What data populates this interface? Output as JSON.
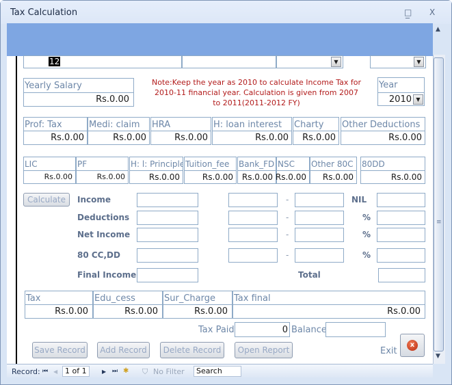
{
  "window": {
    "title": "Tax Calculation",
    "minimize": "_",
    "maximize": "□",
    "close": "X"
  },
  "top_row": {
    "id_value": "12"
  },
  "note": "Note:Keep the year as 2010 to calculate Income Tax for 2010-11 financial year. Calculation is given from 2007 to 2011(2011-2012 FY)",
  "yearly_salary": {
    "label": "Yearly Salary",
    "value": "Rs.0.00"
  },
  "year": {
    "label": "Year",
    "value": "2010"
  },
  "row1": [
    {
      "label": "Prof: Tax",
      "value": "Rs.0.00"
    },
    {
      "label": "Medi: claim",
      "value": "Rs.0.00"
    },
    {
      "label": "HRA",
      "value": "Rs.0.00"
    },
    {
      "label": "H: loan interest",
      "value": "Rs.0.00"
    },
    {
      "label": "Charty",
      "value": "Rs.0.00"
    },
    {
      "label": "Other Deductions",
      "value": "Rs.0.00"
    }
  ],
  "row2": [
    {
      "label": "LIC",
      "value": "Rs.0.00"
    },
    {
      "label": "PF",
      "value": "Rs.0.00"
    },
    {
      "label": "H: l: Principle",
      "value": "Rs.0.00"
    },
    {
      "label": "Tuition_fee",
      "value": "Rs.0.00"
    },
    {
      "label": "Bank_FD",
      "value": "Rs.0.00"
    },
    {
      "label": "NSC",
      "value": "Rs.0.00"
    },
    {
      "label": "Other 80C",
      "value": "Rs.0.00"
    },
    {
      "label": "80DD",
      "value": "Rs.0.00"
    }
  ],
  "calc": {
    "button": "Calculate",
    "rows": [
      {
        "label": "Income",
        "sep": "-",
        "rate": "NIL"
      },
      {
        "label": "Deductions",
        "sep": "-",
        "rate": "%"
      },
      {
        "label": "Net Income",
        "sep": "-",
        "rate": "%"
      },
      {
        "label": "80 CC,DD",
        "sep": "-",
        "rate": "%"
      },
      {
        "label": "Final Income",
        "total_label": "Total"
      }
    ]
  },
  "tax_row": [
    {
      "label": "Tax",
      "value": "Rs.0.00"
    },
    {
      "label": "Edu_cess",
      "value": "Rs.0.00"
    },
    {
      "label": "Sur_Charge",
      "value": "Rs.0.00"
    },
    {
      "label": "Tax final",
      "value": "Rs.0.00"
    }
  ],
  "payment": {
    "tax_paid_label": "Tax Paid",
    "tax_paid_value": "0",
    "balance_label": "Balance",
    "balance_value": ""
  },
  "buttons": {
    "save": "Save Record",
    "add": "Add Record",
    "delete": "Delete Record",
    "report": "Open Report",
    "exit": "Exit"
  },
  "navbar": {
    "record_label": "Record:",
    "position": "1 of 1",
    "filter": "No Filter",
    "search": "Search"
  }
}
